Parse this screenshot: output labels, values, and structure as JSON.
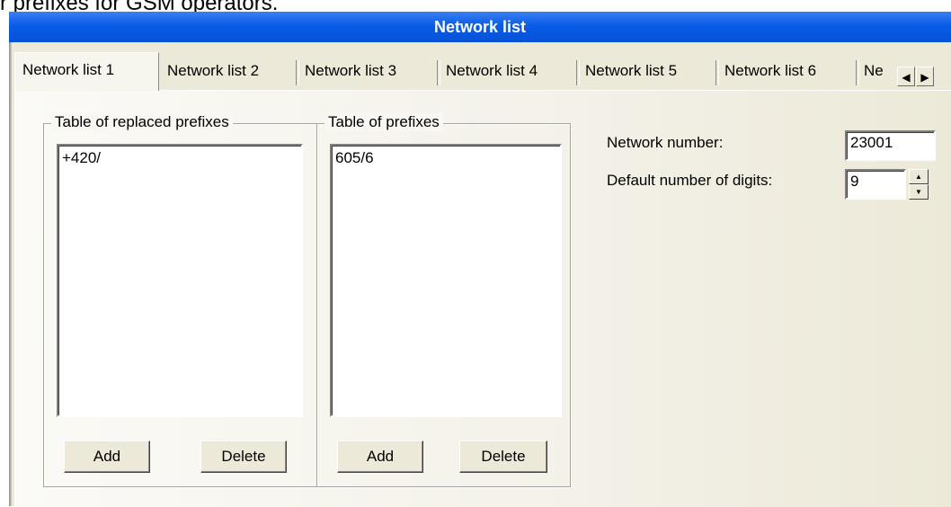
{
  "caption": "r prefixes for GSM operators.",
  "window": {
    "title": "Network list"
  },
  "tabs": [
    {
      "label": "Network list 1",
      "active": true
    },
    {
      "label": "Network list 2"
    },
    {
      "label": "Network list 3"
    },
    {
      "label": "Network list 4"
    },
    {
      "label": "Network list 5"
    },
    {
      "label": "Network list 6"
    },
    {
      "label": "Ne"
    }
  ],
  "tab_scroll": {
    "left_icon": "scroll-left-icon",
    "right_icon": "scroll-right-icon",
    "left_glyph": "◀",
    "right_glyph": "▶"
  },
  "replaced_prefixes": {
    "title": "Table of replaced prefixes",
    "items": [
      "+420/"
    ],
    "add_label": "Add",
    "delete_label": "Delete"
  },
  "prefixes": {
    "title": "Table of prefixes",
    "items": [
      "605/6"
    ],
    "add_label": "Add",
    "delete_label": "Delete"
  },
  "settings": {
    "network_number_label": "Network number:",
    "network_number_value": "23001",
    "default_digits_label": "Default number of digits:",
    "default_digits_value": "9",
    "spin_up": "▲",
    "spin_down": "▼"
  }
}
